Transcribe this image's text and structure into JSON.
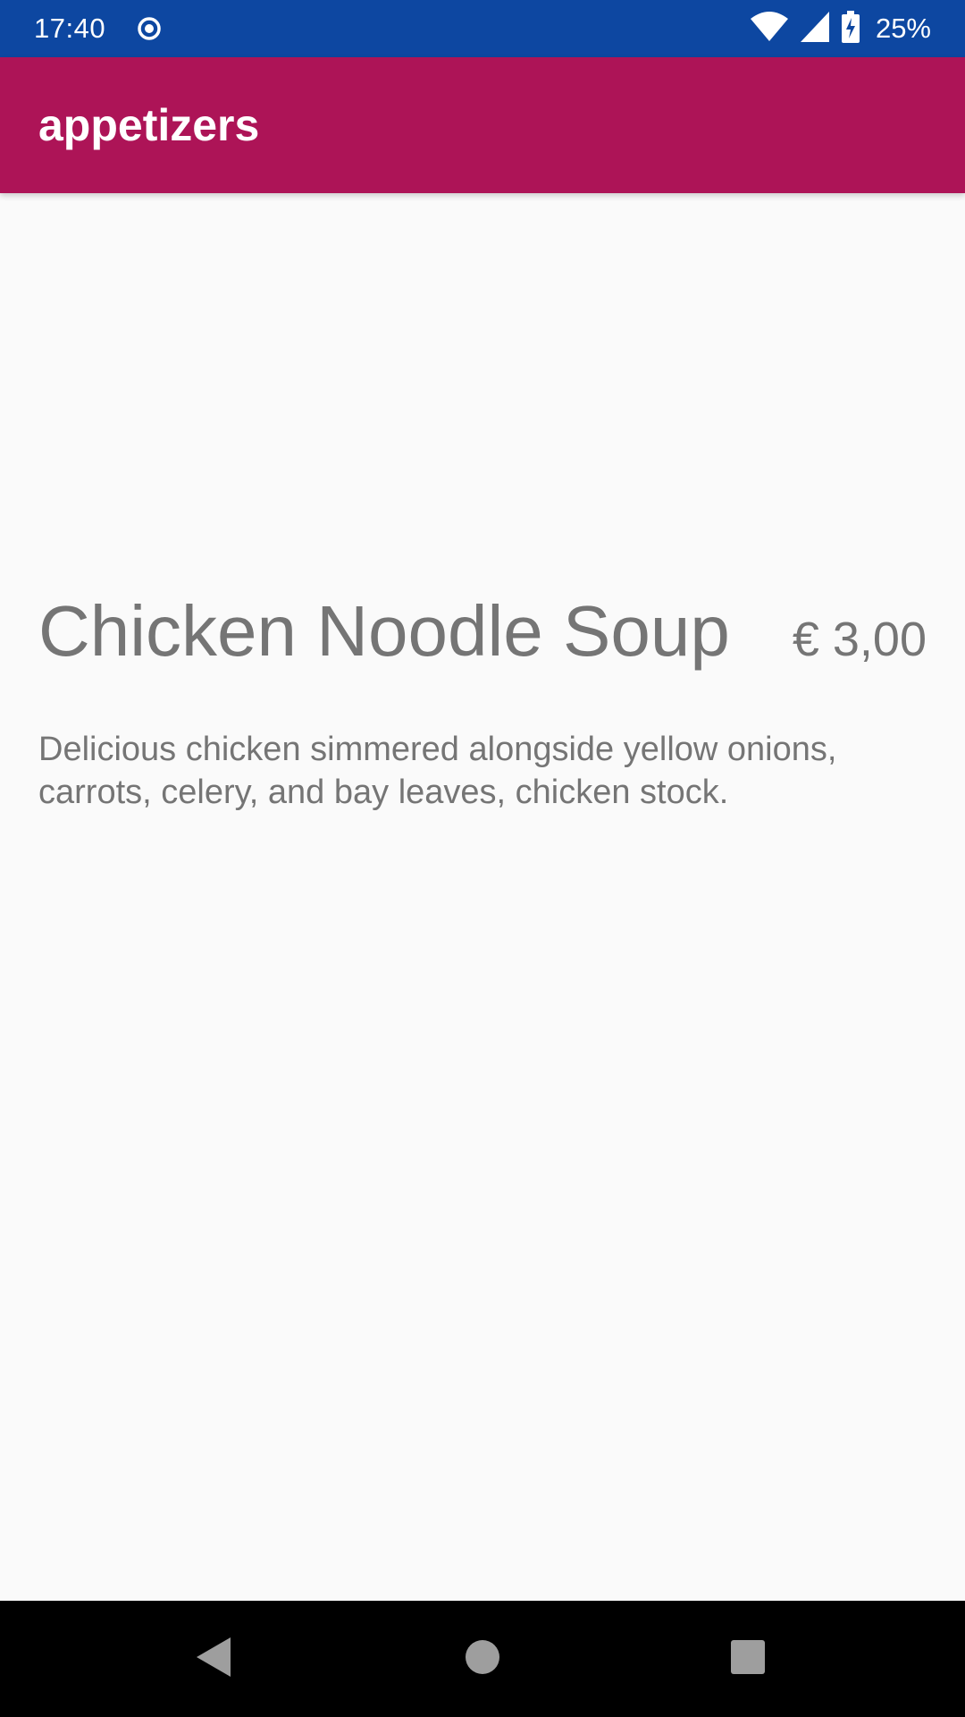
{
  "status_bar": {
    "time": "17:40",
    "battery": "25%",
    "icons": [
      "record-icon",
      "wifi-icon",
      "signal-icon",
      "battery-charging-icon"
    ]
  },
  "app_bar": {
    "title": "appetizers",
    "color": "#ad1457"
  },
  "item": {
    "name": "Chicken Noodle Soup",
    "price": "€ 3,00",
    "description": "Delicious chicken simmered alongside yellow onions, carrots, celery, and bay leaves, chicken stock."
  },
  "nav_bar": {
    "icons": [
      "back-icon",
      "home-icon",
      "recents-icon"
    ]
  },
  "colors": {
    "status_bar": "#0d47a1",
    "text_secondary": "#757575",
    "background": "#fafafa"
  }
}
